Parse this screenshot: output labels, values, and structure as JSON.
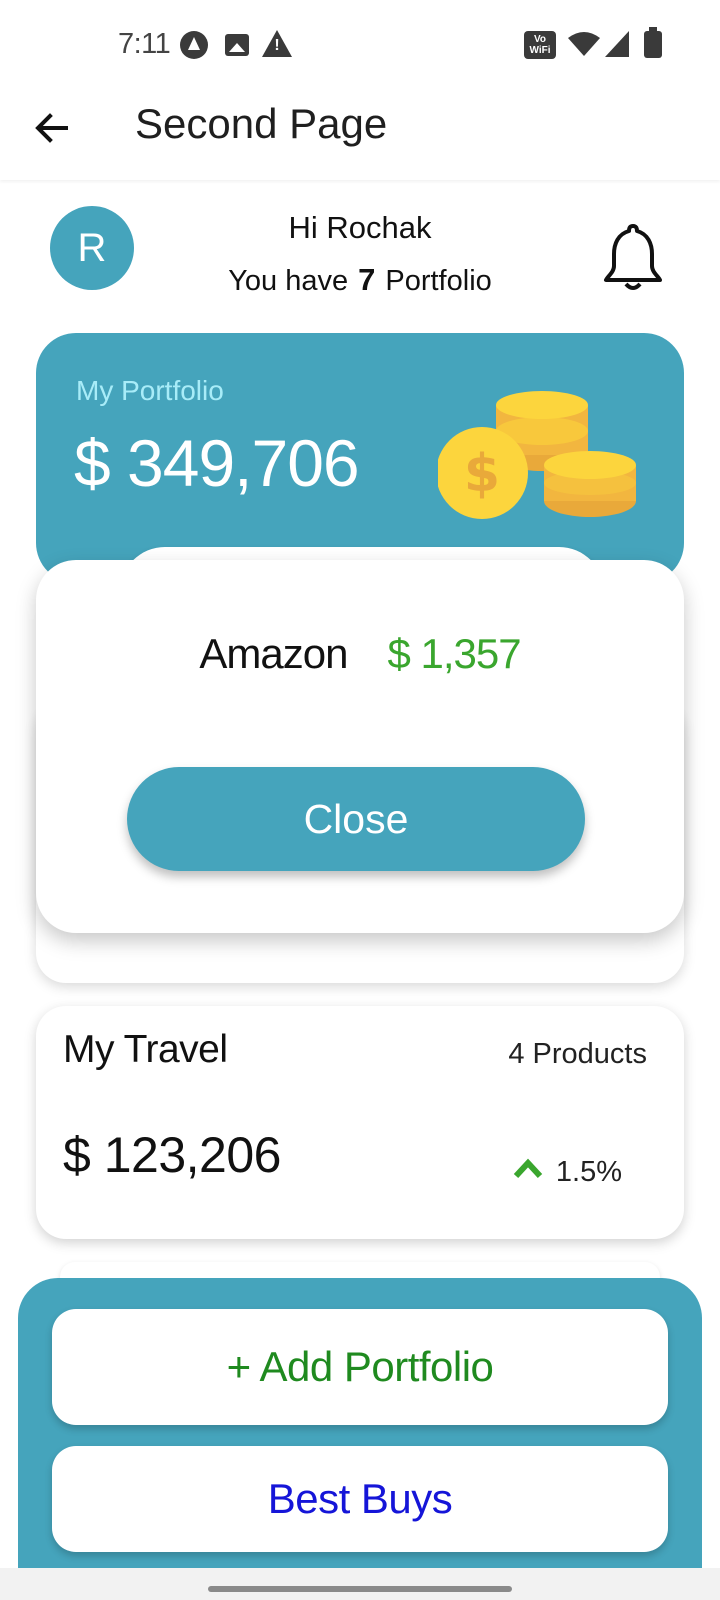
{
  "status_bar": {
    "time": "7:11",
    "icons": [
      "assistant-icon",
      "image-icon",
      "warning-icon",
      "vowifi-icon",
      "wifi-icon",
      "signal-icon",
      "battery-icon"
    ],
    "vowifi_label": "Vo WiFi"
  },
  "app_bar": {
    "title": "Second Page",
    "back_icon": "arrow-left-icon"
  },
  "greeting": {
    "avatar_letter": "R",
    "hello": "Hi Rochak",
    "portfolio_prefix": "You have",
    "portfolio_count": "7",
    "portfolio_suffix": "Portfolio",
    "bell_icon": "bell-icon"
  },
  "portfolio_card": {
    "label": "My Portfolio",
    "value": "$ 349,706",
    "illustration": "coins-icon"
  },
  "dialog": {
    "name": "Amazon",
    "amount": "$ 1,357",
    "close_label": "Close"
  },
  "travel_card": {
    "title": "My Travel",
    "products": "4 Products",
    "value": "$ 123,206",
    "change": "1.5%",
    "trend_icon": "chevron-up-icon"
  },
  "bottom": {
    "add_label": "+ Add Portfolio",
    "best_label": "Best Buys"
  },
  "colors": {
    "accent": "#45a4bc",
    "positive": "#3aa62e",
    "add_text": "#1f8a1f",
    "best_text": "#1515d8"
  }
}
